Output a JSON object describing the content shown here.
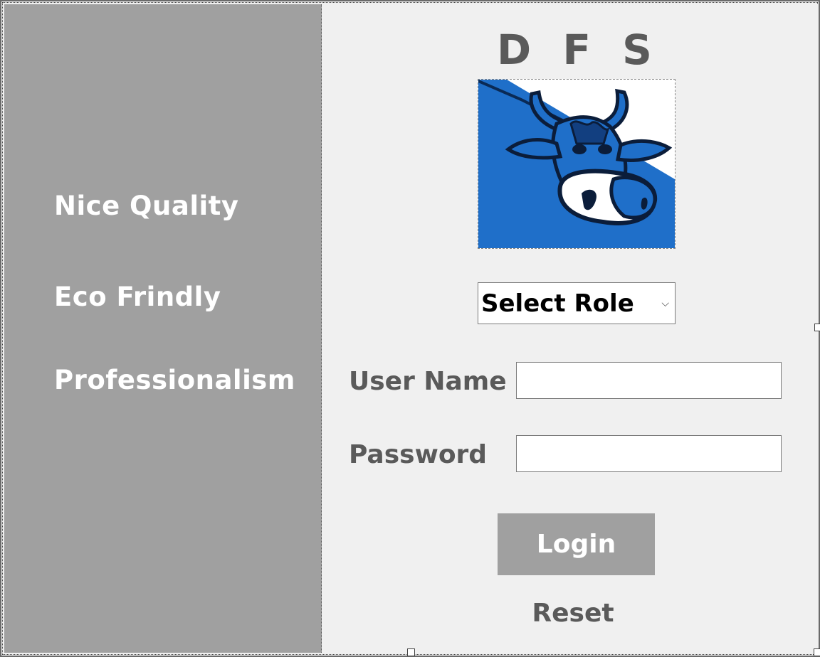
{
  "left_panel": {
    "taglines": [
      "Nice Quality",
      "Eco Frindly",
      "Professionalism"
    ]
  },
  "brand": {
    "title": "D F S",
    "logo_icon": "cow-head-logo"
  },
  "role_select": {
    "selected": "Select Role"
  },
  "form": {
    "username_label": "User Name",
    "username_value": "",
    "password_label": "Password",
    "password_value": ""
  },
  "actions": {
    "login_label": "Login",
    "reset_label": "Reset"
  },
  "colors": {
    "panel_gray": "#a0a0a0",
    "text_gray": "#5a5a5a",
    "logo_blue": "#1f6fc9"
  }
}
